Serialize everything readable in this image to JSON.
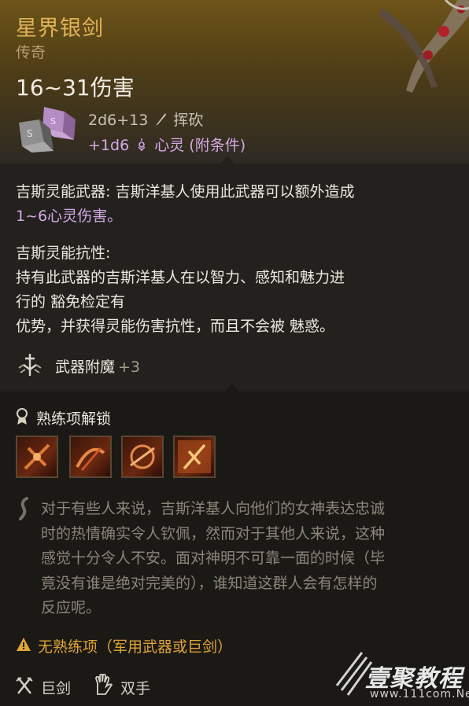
{
  "item": {
    "name": "星界银剑",
    "rarity": "传奇",
    "damage": "16~31伤害",
    "damage_main": "2d6+13",
    "damage_main_type": "挥砍",
    "damage_bonus": "+1d6",
    "damage_bonus_type": "心灵 (附条件)"
  },
  "passives": [
    {
      "name": "吉斯灵能武器:",
      "text_line1": " 吉斯洋基人使用此武器可以额外造成",
      "text_line2": "1~6心灵伤害。"
    },
    {
      "name": "吉斯灵能抗性:",
      "lines": [
        "持有此武器的吉斯洋基人在以智力、感知和魅力进",
        "行的 豁免检定有",
        "优势，并获得灵能伤害抗性，而且不会被 魅惑。"
      ]
    }
  ],
  "enchantment": {
    "label": "武器附魔",
    "value": "+3"
  },
  "proficiency": {
    "title": "熟练项解锁",
    "skills": [
      "skill-1",
      "skill-2",
      "skill-3",
      "skill-4"
    ]
  },
  "lore": [
    "对于有些人来说，吉斯洋基人向他们的女神表达忠诚",
    "时的热情确实令人钦佩，然而对于其他人来说，这种",
    "感觉十分令人不安。面对神明不可靠一面的时候（毕",
    "竟没有谁是绝对完美的），谁知道这群人会有怎样的",
    "反应呢。"
  ],
  "warning": "无熟练项（军用武器或巨剑）",
  "tags": [
    "巨剑",
    "双手"
  ],
  "watermark": {
    "brand": "壹聚教程",
    "url": "www.111com.Net"
  },
  "colors": {
    "title": "#e1b458",
    "psychic": "#d4a8e6",
    "warning": "#e0a536"
  }
}
